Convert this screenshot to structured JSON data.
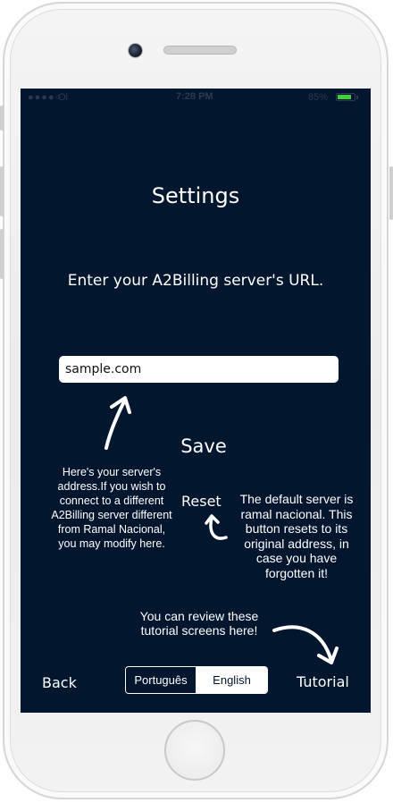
{
  "status_bar": {
    "signal": "●●●●○",
    "carrier": "Oi",
    "time": "7:28 PM",
    "battery_percent": "85%",
    "battery_level": 0.85
  },
  "settings": {
    "title": "Settings",
    "prompt": "Enter your A2Billing server's URL.",
    "url_value": "sample.com",
    "save_label": "Save",
    "reset_label": "Reset"
  },
  "tutorial_notes": {
    "server_note": "Here's your server's\naddress.If you wish to\nconnect to a different\nA2Billing server different\nfrom Ramal Nacional,\nyou may modify here.",
    "reset_note": "The default server is\nramal nacional. This\nbutton resets to its\noriginal address, in\ncase you have\nforgotten it!",
    "tutorial_note": "You can review these\ntutorial screens here!"
  },
  "bottom_bar": {
    "back_label": "Back",
    "tutorial_label": "Tutorial",
    "languages": [
      {
        "label": "Português",
        "selected": false
      },
      {
        "label": "English",
        "selected": true
      }
    ]
  },
  "colors": {
    "screen_background": "#02172e",
    "text": "#ffffff",
    "battery": "#3dd13d"
  }
}
